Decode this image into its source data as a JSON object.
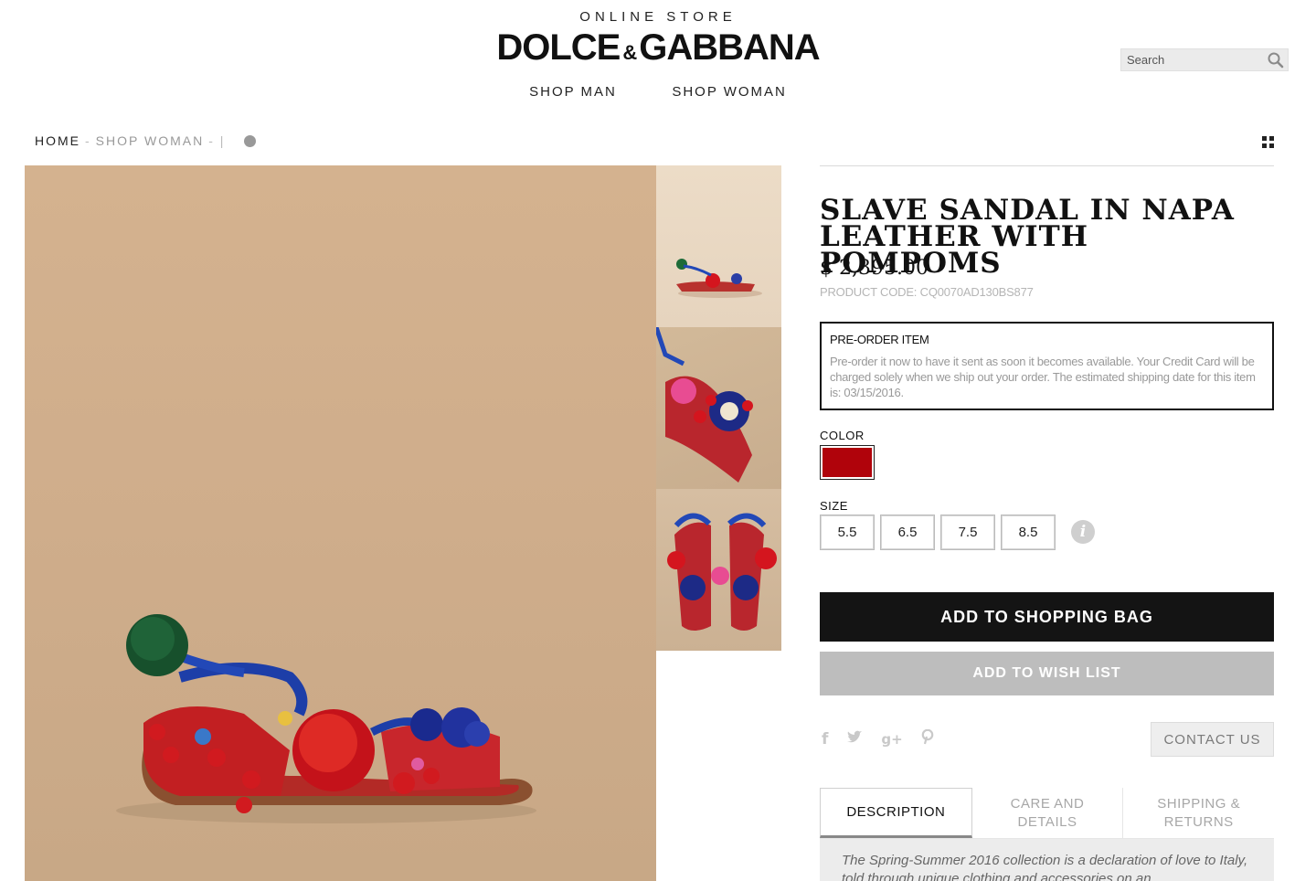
{
  "header": {
    "eyebrow": "ONLINE STORE",
    "logo_left": "DOLCE",
    "logo_amp": "&",
    "logo_right": "GABBANA",
    "nav": [
      {
        "label": "SHOP MAN"
      },
      {
        "label": "SHOP WOMAN"
      }
    ],
    "search_placeholder": "Search"
  },
  "breadcrumb": {
    "home": "HOME",
    "separator": "-",
    "current": "SHOP WOMAN",
    "tail": "- |"
  },
  "product": {
    "title": "SLAVE SANDAL IN NAPA LEATHER WITH POMPOMS",
    "price": "$ 2,395.00",
    "code": "PRODUCT CODE: CQ0070AD130BS877",
    "preorder_title": "PRE-ORDER ITEM",
    "preorder_text": "Pre-order it now to have it sent as soon it becomes available. Your Credit Card will be charged solely when we ship out your order. The estimated shipping date for this item is: 03/15/2016.",
    "color_label": "COLOR",
    "color_hex": "#b0030b",
    "size_label": "SIZE",
    "sizes": [
      "5.5",
      "6.5",
      "7.5",
      "8.5"
    ],
    "add_to_bag": "ADD TO SHOPPING BAG",
    "add_to_wishlist": "ADD TO WISH LIST",
    "contact": "CONTACT US",
    "social_icons": [
      "facebook-icon",
      "twitter-icon",
      "google-plus-icon",
      "pinterest-icon"
    ]
  },
  "tabs": [
    {
      "label": "DESCRIPTION",
      "active": true
    },
    {
      "label": "CARE AND DETAILS",
      "active": false
    },
    {
      "label": "SHIPPING & RETURNS",
      "active": false
    }
  ],
  "description": "The Spring-Summer 2016 collection is a declaration of love to Italy, told through unique clothing and accessories on an"
}
